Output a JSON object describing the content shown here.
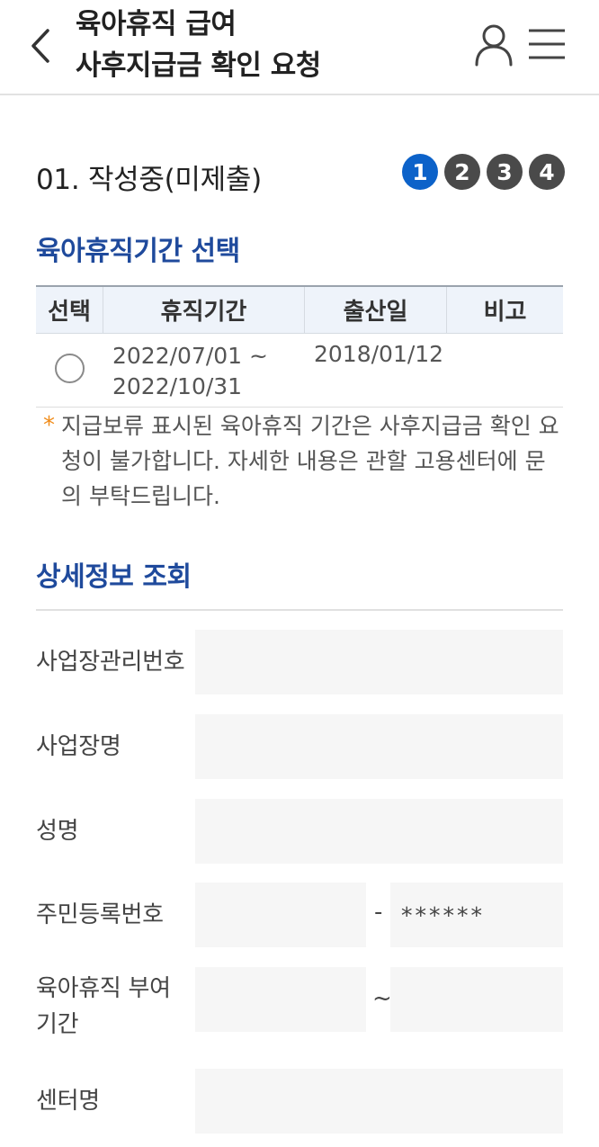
{
  "header": {
    "title_line1": "육아휴직 급여",
    "title_line2": "사후지급금 확인 요청"
  },
  "step": {
    "title": "01. 작성중(미제출)",
    "steps": [
      "1",
      "2",
      "3",
      "4"
    ],
    "active_step": 1,
    "active_color": "#0c62c9",
    "inactive_color": "#4a4a4a"
  },
  "period_section": {
    "title": "육아휴직기간 선택",
    "columns": [
      "선택",
      "휴직기간",
      "출산일",
      "비고"
    ],
    "rows": [
      {
        "period_start": "2022/07/01 ~",
        "period_end": "2022/10/31",
        "birth_date": "2018/01/12",
        "note": ""
      }
    ],
    "notice_mark": "*",
    "notice": "지급보류 표시된 육아휴직 기간은 사후지급금 확인 요청이 불가합니다. 자세한 내용은 관할 고용센터에 문의 부탁드립니다."
  },
  "detail_section": {
    "title": "상세정보 조회",
    "business_no_label": "사업장관리번호",
    "business_name_label": "사업장명",
    "name_label": "성명",
    "resident_no_label": "주민등록번호",
    "resident_no_separator": "-",
    "resident_no_back": "******",
    "leave_period_label_line1": "육아휴직 부여",
    "leave_period_label_line2": "기간",
    "leave_period_separator": "~",
    "center_label": "센터명"
  },
  "colors": {
    "section_title": "#1f4a9c",
    "notice_star": "#f08c1a",
    "field_background": "#f6f6f6"
  },
  "icons": {
    "back": "chevron-left-icon",
    "user": "user-icon",
    "menu": "hamburger-menu-icon"
  }
}
